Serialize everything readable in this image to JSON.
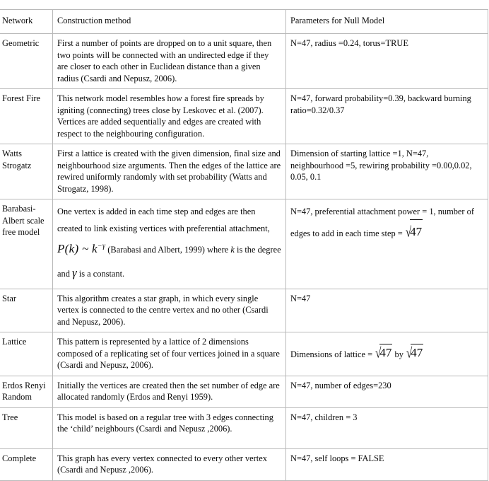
{
  "table": {
    "headers": {
      "network": "Network",
      "method": "Construction method",
      "params": "Parameters for Null Model"
    },
    "rows": [
      {
        "network": "Geometric",
        "method": "First a number of points are dropped on to a unit square, then two points will be connected with an undirected edge if they are closer to each other in Euclidean distance than a given radius (Csardi and Nepusz, 2006).",
        "params": "N=47, radius =0.24, torus=TRUE"
      },
      {
        "network": "Forest Fire",
        "method": "This network model resembles how a forest fire spreads by igniting (connecting) trees close by Leskovec et al. (2007).  Vertices are added sequentially and edges are created with respect to the neighbouring configuration.",
        "params": "N=47, forward probability=0.39, backward burning ratio=0.32/0.37"
      },
      {
        "network": "Watts Strogatz",
        "method": "First a lattice is created with the given dimension, final size and neighbourhood size arguments. Then the edges of the lattice are rewired uniformly randomly with set probability (Watts and Strogatz, 1998).",
        "params": "Dimension of starting lattice =1, N=47, neighbourhood =5, rewiring probability =0.00,0.02, 0.05, 0.1"
      },
      {
        "network": "Barabasi-Albert scale free model",
        "method_part1": "One vertex is added in each time step and edges are then created to link existing vertices with preferential attachment, ",
        "method_formula": "P(k) ~ k",
        "method_formula_sup": "−γ",
        "method_part2": " (Barabasi and Albert, 1999) where ",
        "method_k": "k",
        "method_part3": " is the degree and ",
        "method_gamma": "γ",
        "method_part4": " is a constant.",
        "params_part1": "N=47, preferential attachment power = 1, number of edges to add in each time step  = ",
        "params_sqrt": "47"
      },
      {
        "network": "Star",
        "method": "This algorithm creates a star graph, in which every single vertex is connected to the centre vertex and no other (Csardi and Nepusz, 2006).",
        "params": "N=47"
      },
      {
        "network": "Lattice",
        "method": "This pattern is represented by a lattice of 2 dimensions composed of a replicating set of four vertices joined in a square (Csardi and Nepusz, 2006).",
        "params_prefix": "Dimensions of lattice = ",
        "params_sqrt1": "47",
        "params_mid": " by ",
        "params_sqrt2": "47"
      },
      {
        "network": "Erdos Renyi Random",
        "method": "Initially the vertices are created then the set number of edge are allocated randomly (Erdos and Renyi 1959).",
        "params": "N=47, number of edges=230"
      },
      {
        "network": "Tree",
        "method": "This model is based on a regular tree with 3 edges connecting the ‘child’ neighbours (Csardi and Nepusz ,2006).",
        "params": "N=47, children = 3"
      },
      {
        "network": "Complete",
        "method": "This graph has every vertex connected to every other vertex (Csardi and Nepusz ,2006).",
        "params": "N=47, self loops = FALSE"
      }
    ]
  }
}
